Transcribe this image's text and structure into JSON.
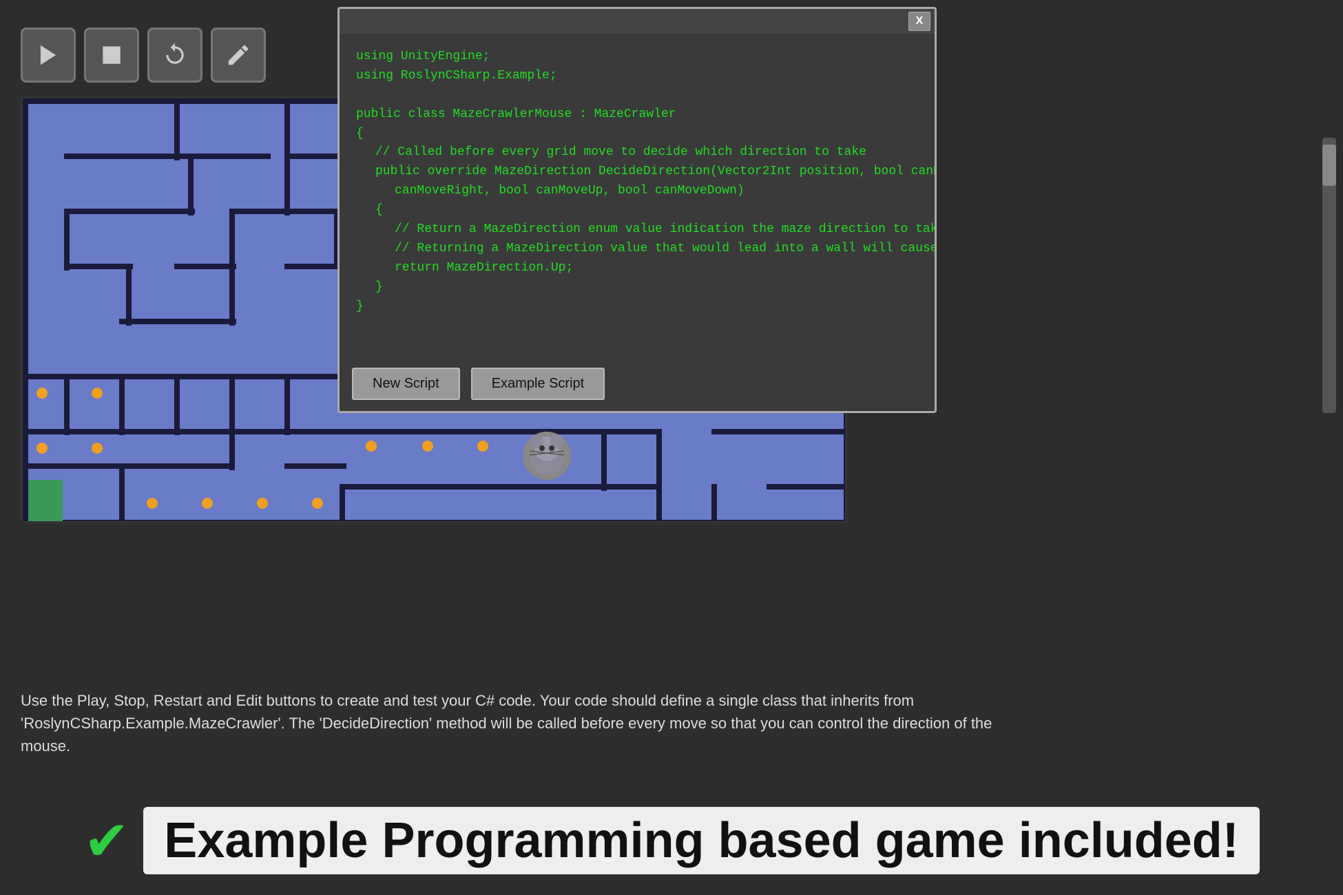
{
  "toolbar": {
    "play_label": "Play",
    "stop_label": "Stop",
    "restart_label": "Restart",
    "edit_label": "Edit"
  },
  "code_modal": {
    "close_label": "X",
    "lines": [
      {
        "indent": 0,
        "text": "using UnityEngine;"
      },
      {
        "indent": 0,
        "text": "using RoslynCSharp.Example;"
      },
      {
        "indent": 0,
        "text": ""
      },
      {
        "indent": 0,
        "text": "public class MazeCrawlerMouse : MazeCrawler"
      },
      {
        "indent": 0,
        "text": "{"
      },
      {
        "indent": 1,
        "text": "// Called before every grid move to decide which direction to take"
      },
      {
        "indent": 1,
        "text": "public override MazeDirection DecideDirection(Vector2Int position, bool canMoveLeft, bool"
      },
      {
        "indent": 2,
        "text": "canMoveRight, bool canMoveUp, bool canMoveDown)"
      },
      {
        "indent": 1,
        "text": "{"
      },
      {
        "indent": 2,
        "text": "// Return a MazeDirection enum value indication the maze direction to take."
      },
      {
        "indent": 2,
        "text": "// Returning a MazeDirection value that would lead into a wall will cause the maze crawl to restart"
      },
      {
        "indent": 2,
        "text": "return MazeDirection.Up;"
      },
      {
        "indent": 1,
        "text": "}"
      },
      {
        "indent": 0,
        "text": "}"
      }
    ],
    "new_script_label": "New Script",
    "example_script_label": "Example Script"
  },
  "description": {
    "text": "Use the Play, Stop, Restart and Edit buttons to create and test your C# code. Your code should define a single class that inherits from\n'RoslynCSharp.Example.MazeCrawler'. The 'DecideDirection' method will be called before every move so that you can control the direction of the\nmouse."
  },
  "banner": {
    "checkmark": "✔",
    "text": "Example Programming based game included!"
  }
}
